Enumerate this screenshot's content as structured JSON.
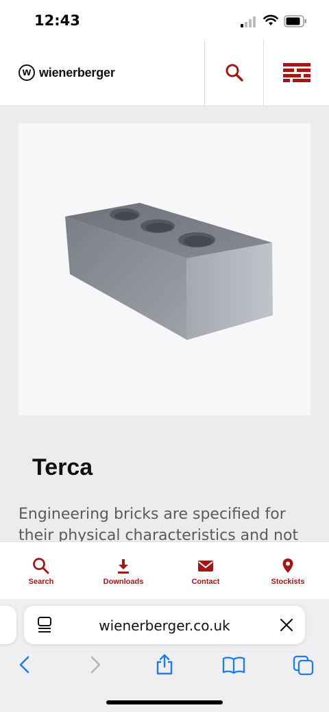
{
  "status_bar": {
    "time": "12:43"
  },
  "header": {
    "brand": "wienerberger",
    "logo_letter": "w"
  },
  "product": {
    "title": "Terca",
    "description": "Engineering bricks are specified for their physical characteristics and not their"
  },
  "bottom_nav": [
    {
      "label": "Search",
      "icon": "search-icon"
    },
    {
      "label": "Downloads",
      "icon": "download-icon"
    },
    {
      "label": "Contact",
      "icon": "envelope-icon"
    },
    {
      "label": "Stockists",
      "icon": "location-pin-icon"
    }
  ],
  "browser": {
    "url": "wienerberger.co.uk"
  },
  "colors": {
    "accent": "#a01914",
    "ios_blue": "#1a7cf5"
  }
}
